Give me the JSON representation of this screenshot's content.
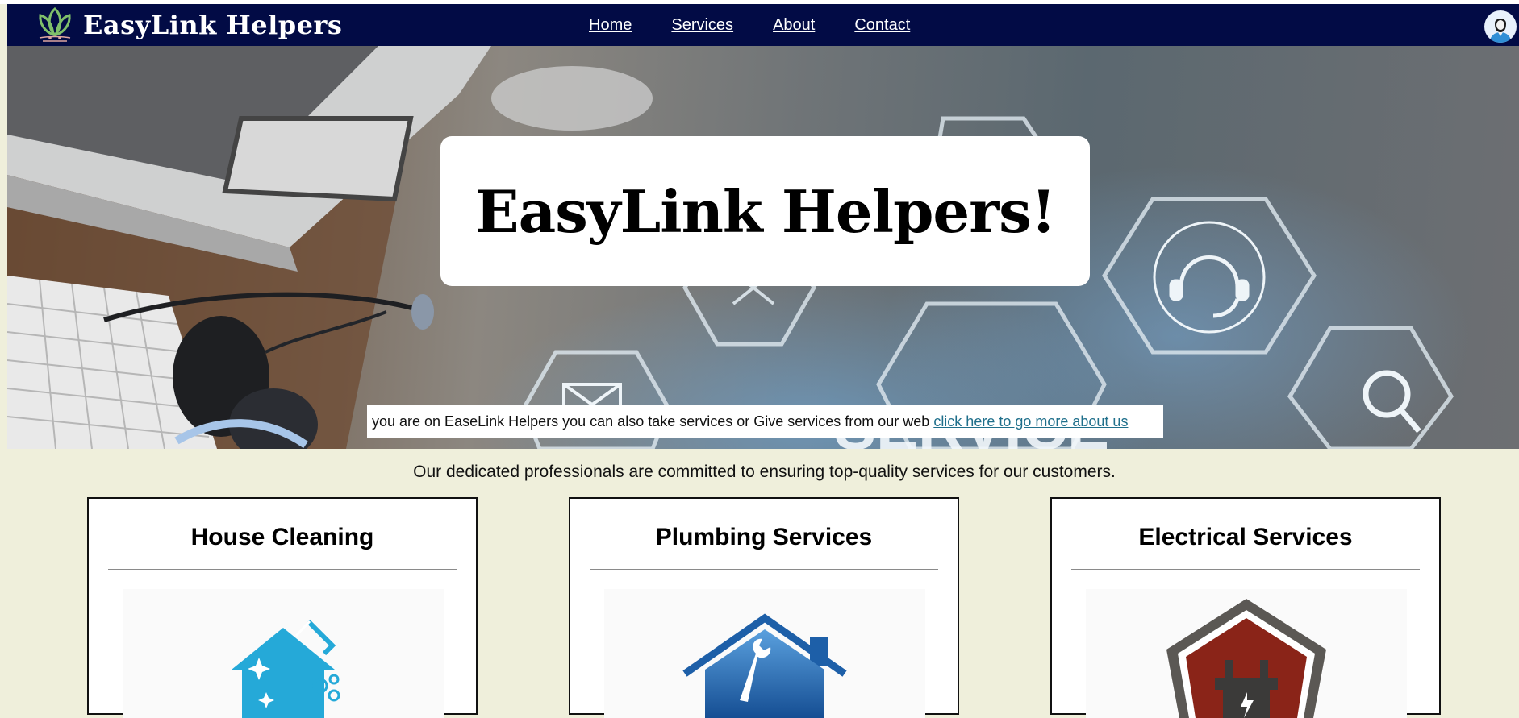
{
  "nav": {
    "brand": "EasyLink Helpers",
    "logo_icon": "lotus-logo-icon",
    "links": [
      "Home",
      "Services",
      "About",
      "Contact"
    ],
    "avatar_icon": "user-avatar-icon",
    "background": "#020b45"
  },
  "hero": {
    "title": "EasyLink Helpers!",
    "strip_text": "you are on EaseLink Helpers you can also take services or Give services from our web",
    "strip_link": "click here to go more about us",
    "background_icons": [
      "laptop",
      "headset",
      "keyboard",
      "wrench-icon",
      "headset-icon",
      "search-icon",
      "mail-icon"
    ],
    "background_word": "SERVICE"
  },
  "tagline": "Our dedicated professionals are committed to ensuring top-quality services for our customers.",
  "cards": [
    {
      "title": "House Cleaning",
      "icon": "cleaning-house-icon",
      "accent": "#25a9d8"
    },
    {
      "title": "Plumbing Services",
      "icon": "plumbing-house-icon",
      "accent": "#1d5fa8"
    },
    {
      "title": "Electrical Services",
      "icon": "electrical-plug-icon",
      "accent": "#8a2418"
    }
  ],
  "colors": {
    "page_background": "#efefdb",
    "link": "#1f6f8b"
  }
}
